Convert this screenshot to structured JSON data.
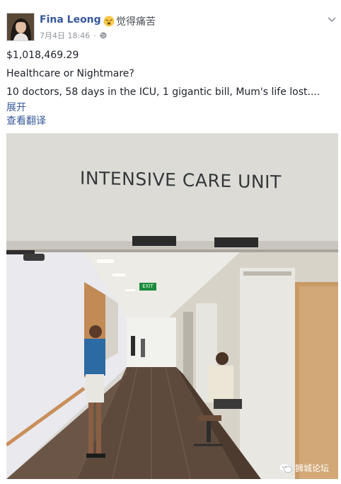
{
  "post": {
    "author": "Fina Leong",
    "feeling": "觉得痛苦",
    "feeling_icon": "pained-face-emoji",
    "timestamp": "7月4日 18:46",
    "separator": "·",
    "privacy_icon": "globe-icon",
    "amount": "$1,018,469.29",
    "headline": "Healthcare or Nightmare?",
    "body": "10 doctors, 58 days in the ICU, 1 gigantic bill, Mum's life lost....",
    "expand_label": "展开",
    "translate_label": "查看翻译"
  },
  "photo": {
    "sign": "INTENSIVE CARE UNIT",
    "exit_sign": "EXIT"
  },
  "watermark": {
    "label": "狮城论坛",
    "icon": "wechat-icon"
  },
  "colors": {
    "link": "#365899",
    "text": "#1d2129",
    "meta": "#90949c"
  }
}
